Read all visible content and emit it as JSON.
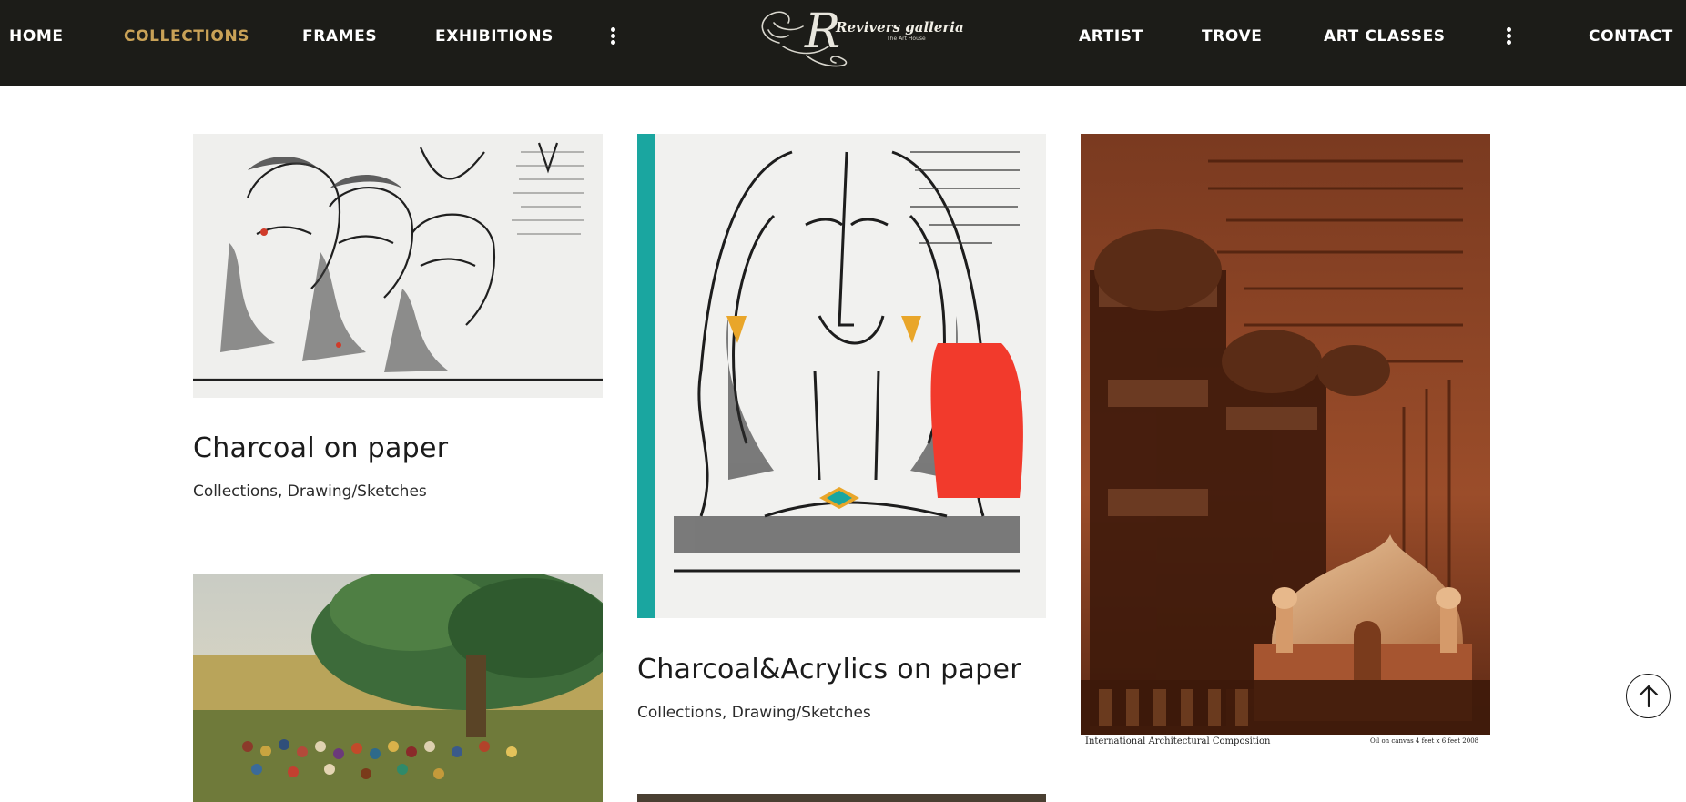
{
  "header": {
    "nav_left": [
      "HOME",
      "COLLECTIONS",
      "FRAMES",
      "EXHIBITIONS"
    ],
    "nav_right": [
      "ARTIST",
      "TROVE",
      "ART CLASSES"
    ],
    "contact": "CONTACT",
    "active_item": "COLLECTIONS",
    "logo": {
      "initial": "R",
      "name": "Revivers galleria",
      "tagline": "The Art House"
    },
    "more_icon": "kebab-vertical-icon"
  },
  "gallery": {
    "cards": [
      {
        "title": "Charcoal on paper",
        "categories": [
          "Collections",
          "Drawing/Sketches"
        ],
        "image": "charcoal-figures-artwork"
      },
      {
        "title": "Charcoal&Acrylics on paper",
        "categories": [
          "Collections",
          "Drawing/Sketches"
        ],
        "image": "charcoal-acrylic-woman-artwork"
      },
      {
        "title": "",
        "categories": [],
        "image": "architectural-composition-painting"
      },
      {
        "title": "",
        "categories": [],
        "image": "village-banyan-tree-painting"
      },
      {
        "title": "",
        "categories": [],
        "image": "dark-painting-partial"
      }
    ],
    "painting_caption": {
      "left": "International Architectural Composition",
      "right": "Oil on canvas  4 feet x 6 feet  2008"
    },
    "category_separator": ", "
  },
  "scroll_top_icon": "arrow-up-icon",
  "colors": {
    "header_bg": "#1c1c18",
    "active_nav": "#c9a257",
    "nav_text": "#ffffff"
  }
}
